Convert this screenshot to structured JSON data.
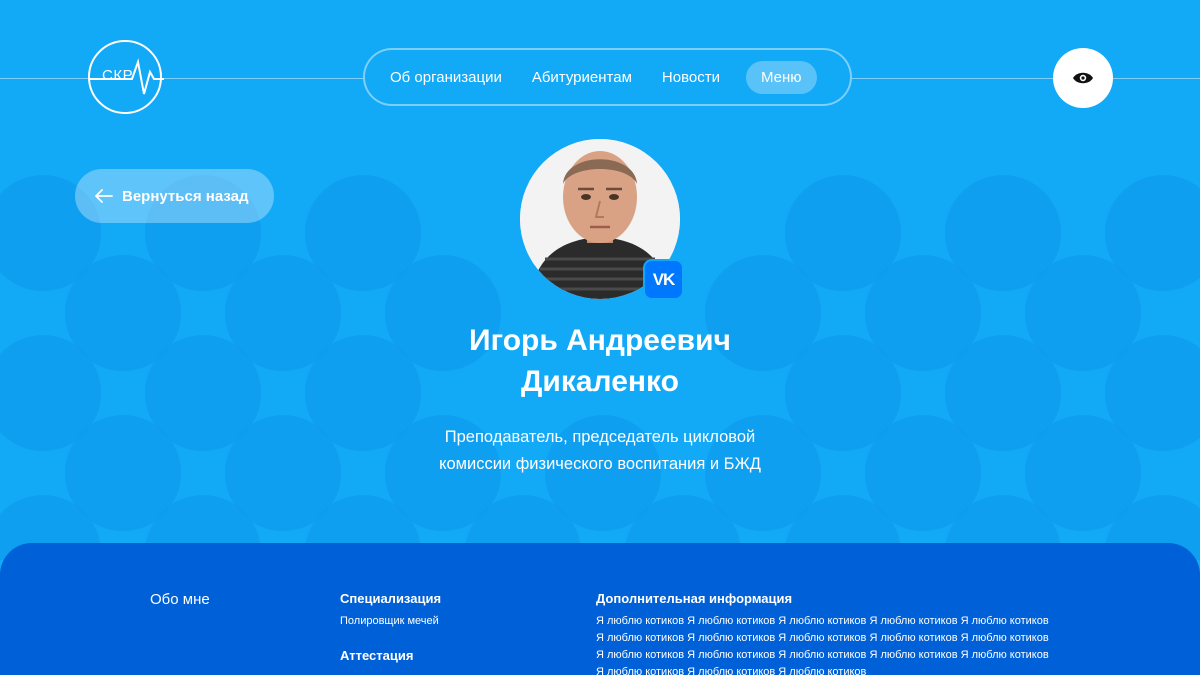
{
  "logo": {
    "text": "СКР"
  },
  "nav": {
    "items": [
      {
        "label": "Об организации"
      },
      {
        "label": "Абитуриентам"
      },
      {
        "label": "Новости"
      }
    ],
    "menu_label": "Меню"
  },
  "accessibility": {
    "icon": "eye-icon"
  },
  "back_button": {
    "label": "Вернуться назад",
    "icon": "arrow-left-icon"
  },
  "profile": {
    "name_line1": "Игорь Андреевич",
    "name_line2": "Дикаленко",
    "role_line1": "Преподаватель, председатель цикловой",
    "role_line2": "комиссии физического воспитания и БЖД",
    "social_badge": "vk-icon"
  },
  "details": {
    "about_title": "Обо мне",
    "specialization_title": "Специализация",
    "specialization_value": "Полировщик мечей",
    "attestation_title": "Аттестация",
    "attestation_value": "",
    "additional_title": "Дополнительная информация",
    "additional_text": "Я люблю котиков Я люблю котиков Я люблю котиков Я люблю котиков Я люблю котиков Я люблю котиков Я люблю котиков Я люблю котиков Я люблю котиков Я люблю котиков Я люблю котиков Я люблю котиков Я люблю котиков Я люблю котиков Я люблю котиков Я люблю котиков Я люблю котиков Я люблю котиков"
  },
  "colors": {
    "background": "#12a9f7",
    "panel": "#0060d8",
    "vk": "#0077ff"
  }
}
